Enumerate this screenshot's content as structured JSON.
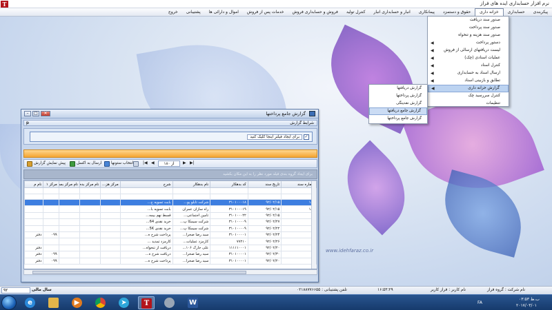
{
  "app": {
    "title": "نرم افزار حسابداری ایده های فراز",
    "icon_letter": "T"
  },
  "menubar": [
    "پیکربندی",
    "حسابداری",
    "خزانه داری",
    "حقوق و دستمزد",
    "پیمانکاری",
    "انبار و حسابداری انبار",
    "کنترل تولید",
    "فروش و حسابداری فروش",
    "خدمات پس از فروش",
    "اموال و دارائی ها",
    "پشتیبانی",
    "خروج"
  ],
  "menubar_active_index": 2,
  "dropdown": [
    {
      "label": "صدور سند دریافت",
      "arrow": false
    },
    {
      "label": "صدور سند پرداخت",
      "arrow": false
    },
    {
      "label": "صدور سند هزینه و تنخواه",
      "arrow": false
    },
    {
      "label": "دستور پرداخت",
      "arrow": true
    },
    {
      "label": "لیست دریافتهای ارسالی از فروش",
      "arrow": true
    },
    {
      "label": "عملیات اسنادی (چک)",
      "arrow": true
    },
    {
      "label": "کنترل اسناد",
      "arrow": true
    },
    {
      "label": "ارسال اسناد به حسابداری",
      "arrow": true
    },
    {
      "label": "تطابق و بازبینی اسناد",
      "arrow": true
    },
    {
      "label": "گزارش خزانه داری",
      "arrow": true,
      "highlight": true
    },
    {
      "label": "کنترل سررسید چک",
      "arrow": false
    },
    {
      "label": "تنظیمات",
      "arrow": false
    }
  ],
  "submenu": [
    {
      "label": "گزارش دریافتها"
    },
    {
      "label": "گزارش پرداختها"
    },
    {
      "label": "گزارش نقدینگی"
    },
    {
      "label": "گزارش جامع دریافتها",
      "highlight": true
    },
    {
      "label": "گزارش جامع پرداختها"
    }
  ],
  "report_window": {
    "title": "گزارش جامع پرداختها",
    "section_title": "شرایط گزارش",
    "pin": "ᵽ",
    "filter_text": "برای ایجاد فیلتر اینجا کلیک کنید",
    "filter_checked": "✓",
    "toolbar": {
      "preview": "پیش نمایش گزارش",
      "excel": "ارسال به اکسل",
      "columns": "انتخاب ستونها",
      "pager": "از ۱۸۰",
      "page_num": "1"
    },
    "group_hint": "برای ایجاد گروه بندی فیلد مورد نظر را به این مکان بکشید",
    "columns": [
      "شماره سند",
      "تاریخ سند",
      "کد بدهکار",
      "نام بدهکار",
      "شرح",
      "مرکز هز...",
      "نام مرکز بده...",
      "نام مرکز بستا...",
      "مرکز ۱",
      "نام م"
    ],
    "rows": [
      {
        "no": "۱۸۰",
        "date": "۹۲/۰۲/۱۵",
        "code": "۳۱۰۱۰۰۰۱۸",
        "name": "شرکت تابلو پو...",
        "desc": "بابت تسویه ج...",
        "c1": "",
        "c2": "",
        "c3": "",
        "c4": "",
        "c5": "",
        "selected": true
      },
      {
        "no": "۱۸۱",
        "date": "۹۲/۰۲/۱۵",
        "code": "۳۱۰۱۰۰۰۱۹",
        "name": "راه سازان عمران",
        "desc": "بابت تسویه با...",
        "c1": "",
        "c2": "",
        "c3": "",
        "c4": "",
        "c5": ""
      },
      {
        "no": "۲",
        "date": "۹۲/۰۲/۱۵",
        "code": "۳۱۰۱۰۰۰۲۲",
        "name": "تامین اجتماعی...",
        "desc": "قسط نهم بیمه...",
        "c1": "",
        "c2": "",
        "c3": "",
        "c4": "",
        "c5": ""
      },
      {
        "no": "۳",
        "date": "۹۲/۰۲/۲۷",
        "code": "۳۱۰۱۰۰۰۰۹",
        "name": "شرکت سیمکا پ...",
        "desc": "خرید نقدی 64...",
        "c1": "",
        "c2": "",
        "c3": "",
        "c4": "",
        "c5": ""
      },
      {
        "no": "۴",
        "date": "۹۲/۰۲/۲۲",
        "code": "۳۱۰۱۰۰۰۰۹",
        "name": "شرکت سیمکا پ...",
        "desc": "خرید نقدی 5K...",
        "c1": "",
        "c2": "",
        "c3": "",
        "c4": "",
        "c5": ""
      },
      {
        "no": "۷",
        "date": "۹۲/۰۲/۲۴",
        "code": "۳۱۰۱۰۰۰۰۱",
        "name": "سید رضا صحرا...",
        "desc": "پرداخت شرح ه...",
        "c1": "",
        "c2": "",
        "c3": "",
        "c4": "۰۹۹",
        "c5": "دفتر"
      },
      {
        "no": "۸",
        "date": "۹۲/۰۲/۲۶",
        "code": "۷۷۲۱۰",
        "name": "کارمزد عملیات...",
        "desc": "کارمزد تمدید ...",
        "c1": "",
        "c2": "",
        "c3": "",
        "c4": "",
        "c5": ""
      },
      {
        "no": "۹",
        "date": "۹۲/۰۲/۲۰",
        "code": "۱۱۱۱۱۰۰۰۱",
        "name": "علی جارک ۱۰۶...",
        "desc": "دریافت از تنخواه...",
        "c1": "",
        "c2": "",
        "c3": "",
        "c4": "",
        "c5": "دفتر"
      },
      {
        "no": "۱۱",
        "date": "۹۲/۰۲/۳۰",
        "code": "۳۱۰۱۰۰۰۰۱",
        "name": "سید رضا صحرا...",
        "desc": "دریافت شرح ه...",
        "c1": "",
        "c2": "",
        "c3": "",
        "c4": "۰۹۹",
        "c5": "دفتر"
      },
      {
        "no": "۱۲",
        "date": "۹۲/۰۲/۲۰",
        "code": "۳۱۰۱۰۰۰۰۱",
        "name": "سید رضا صحرا...",
        "desc": "پرداخت شرح ه...",
        "c1": "",
        "c2": "",
        "c3": "",
        "c4": "۰۹۹",
        "c5": "دفتر"
      }
    ]
  },
  "watermark": "www.idehfaraz.co.ir",
  "app_status": {
    "company": "نام شرکت : گروه فراز",
    "user": "نام کاربر : فراز کاربر",
    "time": "۱۶:۵۳:۲۹",
    "support": "تلفن پشتیبانی : ۰۲۱۸۸۷۷۶۶۵۵",
    "year_label": "سال مالی",
    "year_value": "۹۲"
  },
  "taskbar": {
    "tray_lang": "FA",
    "clock_time": "۰۳:۵۳ ب.ظ",
    "clock_date": "۲۰۱۷/۰۳/۰۱"
  },
  "colors": {
    "selection": "#3d7ee0",
    "menu_highlight": "#bcd3f1",
    "orange_bar": "#f4a531",
    "taskbar": "#1e4b83"
  }
}
